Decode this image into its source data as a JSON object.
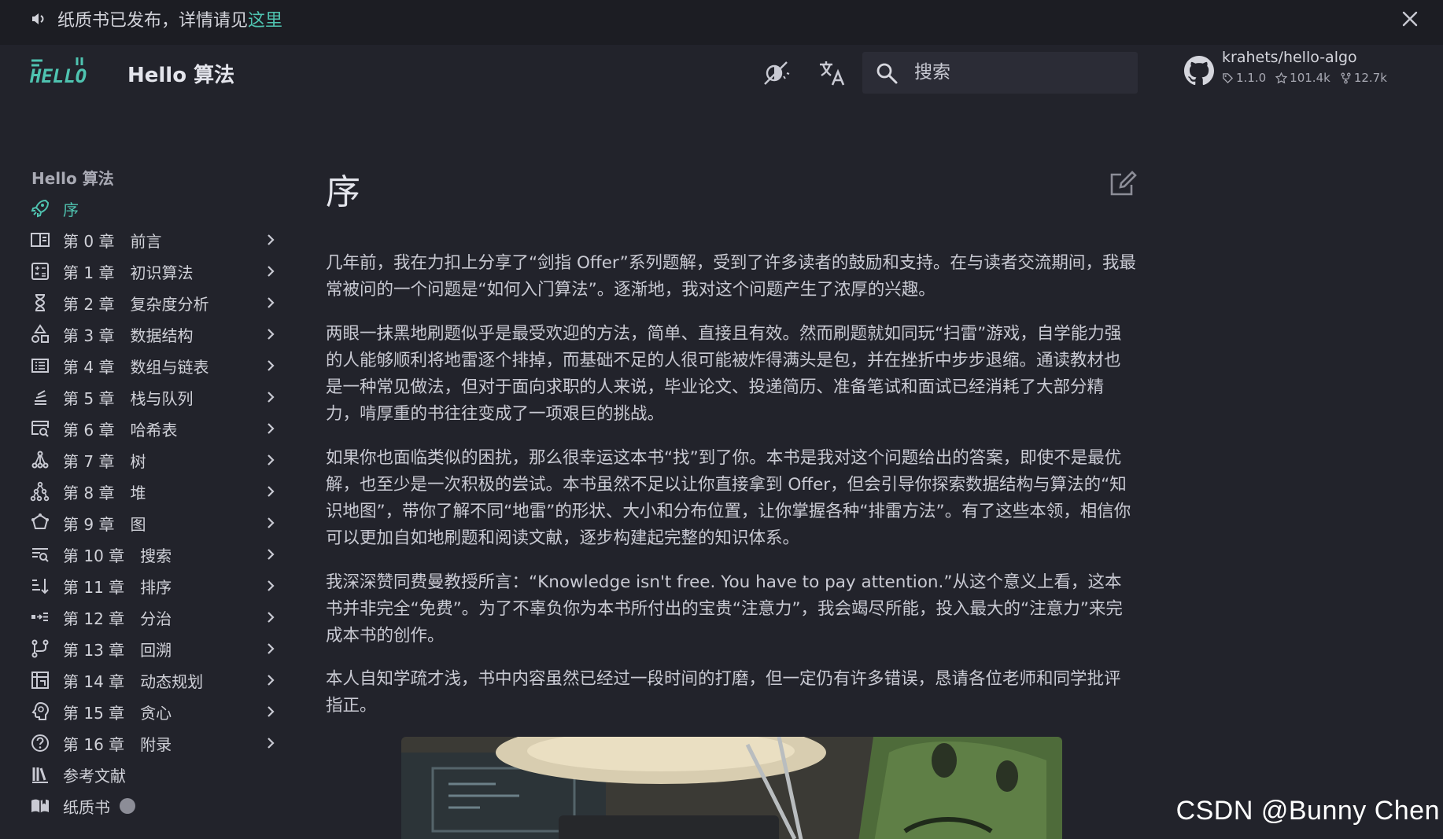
{
  "announcement": {
    "text": "纸质书已发布，详情请见",
    "link_text": "这里"
  },
  "header": {
    "logo_text": "HELLO",
    "title": "Hello 算法",
    "search_placeholder": "搜索",
    "repo": {
      "name": "krahets/hello-algo",
      "version": "1.1.0",
      "stars": "101.4k",
      "forks": "12.7k"
    }
  },
  "sidebar": {
    "heading": "Hello 算法",
    "items": [
      {
        "label": "序",
        "icon": "rocket-icon",
        "active": true,
        "expandable": false
      },
      {
        "label": "第 0 章　前言",
        "icon": "book-open-icon",
        "expandable": true
      },
      {
        "label": "第 1 章　初识算法",
        "icon": "calculator-icon",
        "expandable": true
      },
      {
        "label": "第 2 章　复杂度分析",
        "icon": "hourglass-icon",
        "expandable": true
      },
      {
        "label": "第 3 章　数据结构",
        "icon": "shapes-icon",
        "expandable": true
      },
      {
        "label": "第 4 章　数组与链表",
        "icon": "list-box-icon",
        "expandable": true
      },
      {
        "label": "第 5 章　栈与队列",
        "icon": "stack-icon",
        "expandable": true
      },
      {
        "label": "第 6 章　哈希表",
        "icon": "table-search-icon",
        "expandable": true
      },
      {
        "label": "第 7 章　树",
        "icon": "tree-icon",
        "expandable": true
      },
      {
        "label": "第 8 章　堆",
        "icon": "heap-icon",
        "expandable": true
      },
      {
        "label": "第 9 章　图",
        "icon": "graph-icon",
        "expandable": true
      },
      {
        "label": "第 10 章　搜索",
        "icon": "search-list-icon",
        "expandable": true
      },
      {
        "label": "第 11 章　排序",
        "icon": "sort-icon",
        "expandable": true
      },
      {
        "label": "第 12 章　分治",
        "icon": "divide-icon",
        "expandable": true
      },
      {
        "label": "第 13 章　回溯",
        "icon": "backtrack-icon",
        "expandable": true
      },
      {
        "label": "第 14 章　动态规划",
        "icon": "table-pivot-icon",
        "expandable": true
      },
      {
        "label": "第 15 章　贪心",
        "icon": "head-lightbulb-icon",
        "expandable": true
      },
      {
        "label": "第 16 章　附录",
        "icon": "help-circle-icon",
        "expandable": true
      },
      {
        "label": "参考文献",
        "icon": "library-icon",
        "expandable": false
      },
      {
        "label": "纸质书",
        "icon": "book-open-variant-icon",
        "expandable": false,
        "badge": true
      }
    ]
  },
  "main": {
    "title": "序",
    "paragraphs": [
      "几年前，我在力扣上分享了“剑指 Offer”系列题解，受到了许多读者的鼓励和支持。在与读者交流期间，我最常被问的一个问题是“如何入门算法”。逐渐地，我对这个问题产生了浓厚的兴趣。",
      "两眼一抹黑地刷题似乎是最受欢迎的方法，简单、直接且有效。然而刷题就如同玩“扫雷”游戏，自学能力强的人能够顺利将地雷逐个排掉，而基础不足的人很可能被炸得满头是包，并在挫折中步步退缩。通读教材也是一种常见做法，但对于面向求职的人来说，毕业论文、投递简历、准备笔试和面试已经消耗了大部分精力，啃厚重的书往往变成了一项艰巨的挑战。",
      "如果你也面临类似的困扰，那么很幸运这本书“找”到了你。本书是我对这个问题给出的答案，即使不是最优解，也至少是一次积极的尝试。本书虽然不足以让你直接拿到 Offer，但会引导你探索数据结构与算法的“知识地图”，带你了解不同“地雷”的形状、大小和分布位置，让你掌握各种“排雷方法”。有了这些本领，相信你可以更加自如地刷题和阅读文献，逐步构建起完整的知识体系。",
      "我深深赞同费曼教授所言：“Knowledge isn't free. You have to pay attention.”从这个意义上看，这本书并非完全“免费”。为了不辜负你为本书所付出的宝贵“注意力”，我会竭尽所能，投入最大的“注意力”来完成本书的创作。",
      "本人自知学疏才浅，书中内容虽然已经过一段时间的打磨，但一定仍有许多错误，恳请各位老师和同学批评指正。"
    ]
  },
  "watermark": "CSDN @Bunny Chen",
  "colors": {
    "background": "#22232b",
    "announce_bg": "#1c1d23",
    "accent": "#4fc3b0",
    "text": "#c9cad3"
  }
}
